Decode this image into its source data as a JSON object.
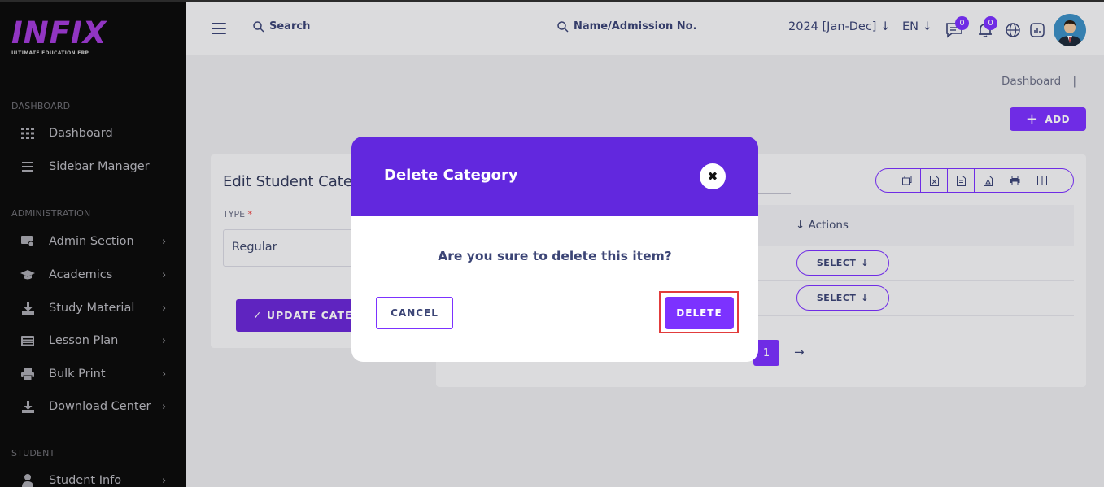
{
  "sidebar": {
    "logo": "INFIX",
    "logo_sub": "ULTIMATE EDUCATION ERP",
    "sections": [
      {
        "title": "DASHBOARD",
        "items": [
          {
            "label": "Dashboard",
            "icon": "grid-icon"
          },
          {
            "label": "Sidebar Manager",
            "icon": "bars-icon"
          }
        ]
      },
      {
        "title": "ADMINISTRATION",
        "items": [
          {
            "label": "Admin Section",
            "icon": "admin-icon"
          },
          {
            "label": "Academics",
            "icon": "graduation-cap-icon"
          },
          {
            "label": "Study Material",
            "icon": "download-icon"
          },
          {
            "label": "Lesson Plan",
            "icon": "list-icon"
          },
          {
            "label": "Bulk Print",
            "icon": "printer-icon"
          },
          {
            "label": "Download Center",
            "icon": "download-icon"
          }
        ]
      },
      {
        "title": "STUDENT",
        "items": [
          {
            "label": "Student Info",
            "icon": "user-icon"
          }
        ]
      }
    ]
  },
  "header": {
    "search_label": "Search",
    "admission_search": "Name/Admission No.",
    "year": "2024 [Jan-Dec]",
    "language": "EN",
    "messages_count": "0",
    "notifications_count": "0"
  },
  "breadcrumb": "Dashboard",
  "breadcrumb_sep": "|",
  "add_button": "ADD",
  "edit_card": {
    "title": "Edit Student Category",
    "type_label": "TYPE",
    "required_mark": "*",
    "type_value": "Regular",
    "update_button": "UPDATE CATEGORY"
  },
  "table": {
    "actions_header": "Actions",
    "select_label": "SELECT",
    "page": "1"
  },
  "modal": {
    "title": "Delete Category",
    "question": "Are you sure to delete this item?",
    "cancel": "CANCEL",
    "delete": "DELETE"
  },
  "colors": {
    "accent": "#7c32ff",
    "modal_header": "#6228de",
    "highlight": "#e23c3c"
  }
}
